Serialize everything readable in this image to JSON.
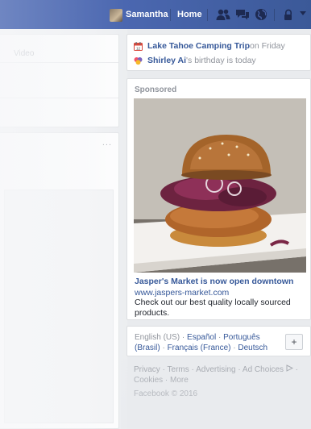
{
  "header": {
    "user_name": "Samantha",
    "home_label": "Home",
    "icons": [
      "friends-icon",
      "messages-icon",
      "globe-icon",
      "lock-icon",
      "chevron-down-icon"
    ],
    "bar_color": "#3b5998"
  },
  "feed": {
    "composer_tab": "Video",
    "more_label": "..."
  },
  "events": [
    {
      "icon": "calendar-icon",
      "title": "Lake Tahoe Camping Trip",
      "suffix": " on Friday"
    },
    {
      "icon": "birthday-icon",
      "title": "Shirley Ai",
      "suffix": "'s birthday is today"
    }
  ],
  "sponsored": {
    "label": "Sponsored",
    "ad_title": "Jasper's Market is now open downtown",
    "ad_url": "www.jaspers-market.com",
    "ad_description": "Check out our best quality locally sourced products."
  },
  "languages": {
    "current": "English (US)",
    "options": [
      "Español",
      "Português (Brasil)",
      "Français (France)",
      "Deutsch"
    ],
    "add_label": "+"
  },
  "footer": {
    "links": [
      "Privacy",
      "Terms",
      "Advertising",
      "Ad Choices",
      "Cookies",
      "More"
    ],
    "copyright": "Facebook © 2016"
  },
  "colors": {
    "link": "#365899",
    "muted": "#90949c",
    "background": "#e9ebee"
  }
}
